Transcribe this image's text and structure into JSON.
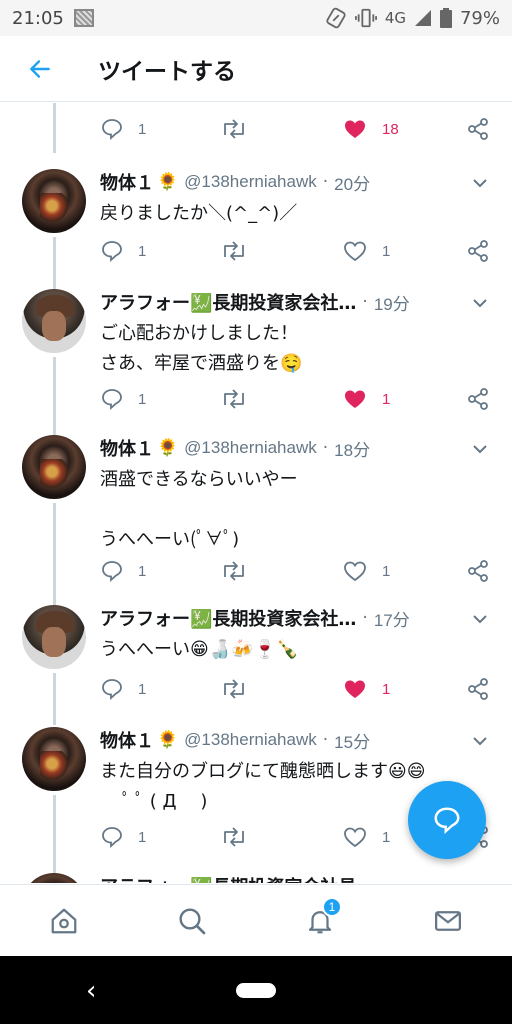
{
  "status_bar": {
    "time": "21:05",
    "network": "4G",
    "battery": "79%"
  },
  "header": {
    "title": "ツイートする",
    "back_icon": "back-arrow-icon"
  },
  "colors": {
    "accent": "#1da1f2",
    "like": "#e0245e",
    "muted": "#657786"
  },
  "top_actions": {
    "reply_count": "1",
    "like_count": "18",
    "liked": true
  },
  "tweets": [
    {
      "name": "物体１",
      "name_emoji": "🌻",
      "handle": "@138herniahawk",
      "time": "20分",
      "body": "戻りましたか＼(^_^)／",
      "reply_count": "1",
      "like_count": "1",
      "liked": false
    },
    {
      "name": "アラフォー💹長期投資家会社…",
      "name_emoji": "",
      "handle": "",
      "time": "19分",
      "body": "ご心配おかけしました！\nさあ、牢屋で酒盛りを🤤",
      "reply_count": "1",
      "like_count": "1",
      "liked": true
    },
    {
      "name": "物体１",
      "name_emoji": "🌻",
      "handle": "@138herniahawk",
      "time": "18分",
      "body": "酒盛できるならいいやー\n\nうへへーい(ﾟ∀ﾟ)",
      "reply_count": "1",
      "like_count": "1",
      "liked": false
    },
    {
      "name": "アラフォー💹長期投資家会社…",
      "name_emoji": "",
      "handle": "",
      "time": "17分",
      "body": "うへへーい😁🍶🍻🍷🍾",
      "reply_count": "1",
      "like_count": "1",
      "liked": true
    },
    {
      "name": "物体１",
      "name_emoji": "🌻",
      "handle": "@138herniahawk",
      "time": "15分",
      "body": "また自分のブログにて醜態晒します😃😄\n　 ﾟ ﾟ ( Д 　)",
      "reply_count": "1",
      "like_count": "1",
      "liked": false
    }
  ],
  "partial_next": {
    "name": "アラフォー💹長期投資家会社員"
  },
  "tabs": [
    {
      "icon": "home-icon"
    },
    {
      "icon": "search-icon"
    },
    {
      "icon": "notifications-icon",
      "badge": "1"
    },
    {
      "icon": "messages-icon"
    }
  ],
  "fab_icon": "reply-compose-icon"
}
